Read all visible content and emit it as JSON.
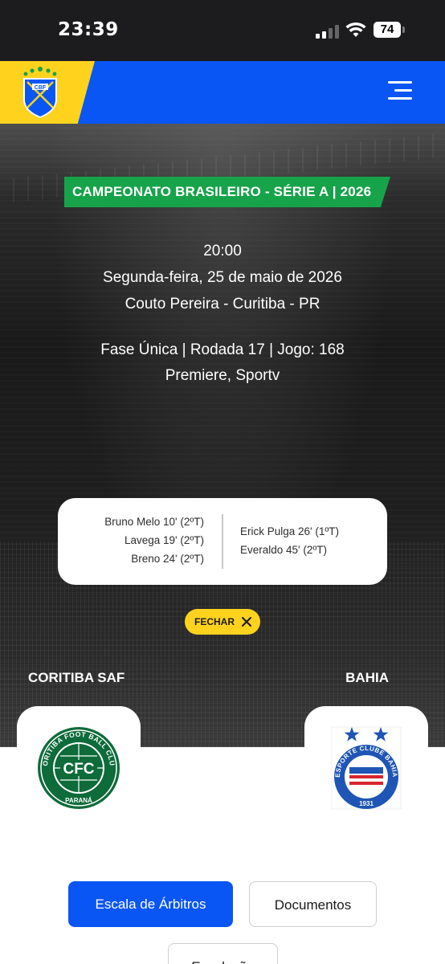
{
  "status_bar": {
    "time": "23:39",
    "battery": "74"
  },
  "header": {
    "logo_text": "CBF"
  },
  "match": {
    "competition": "CAMPEONATO BRASILEIRO - SÉRIE A | 2026",
    "time": "20:00",
    "date": "Segunda-feira, 25 de maio de 2026",
    "venue": "Couto Pereira - Curitiba - PR",
    "phase": "Fase Única | Rodada 17 | Jogo: 168",
    "broadcast": "Premiere, Sportv"
  },
  "goals": {
    "home": [
      "Bruno Melo 10' (2ºT)",
      "Lavega 19' (2ºT)",
      "Breno 24' (2ºT)"
    ],
    "away": [
      "Erick Pulga 26' (1ºT)",
      "Everaldo 45' (2ºT)"
    ]
  },
  "close_button": {
    "label": "FECHAR"
  },
  "home_team": {
    "name": "CORITIBA SAF",
    "crest_text": "CFC",
    "crest_ring": "CORITIBA FOOT BALL CLUB",
    "crest_bottom": "PARANÁ",
    "color": "#0e6b3a"
  },
  "away_team": {
    "name": "BAHIA",
    "crest_ring": "ESPORTE CLUBE BAHIA",
    "crest_year": "1931",
    "color": "#1f55b5"
  },
  "actions": [
    {
      "label": "Escala de Árbitros"
    },
    {
      "label": "Documentos"
    },
    {
      "label": "Escalação"
    }
  ],
  "colors": {
    "cbf_blue": "#0a56f4",
    "cbf_yellow": "#ffd21e",
    "tag_green": "#17a34a"
  }
}
